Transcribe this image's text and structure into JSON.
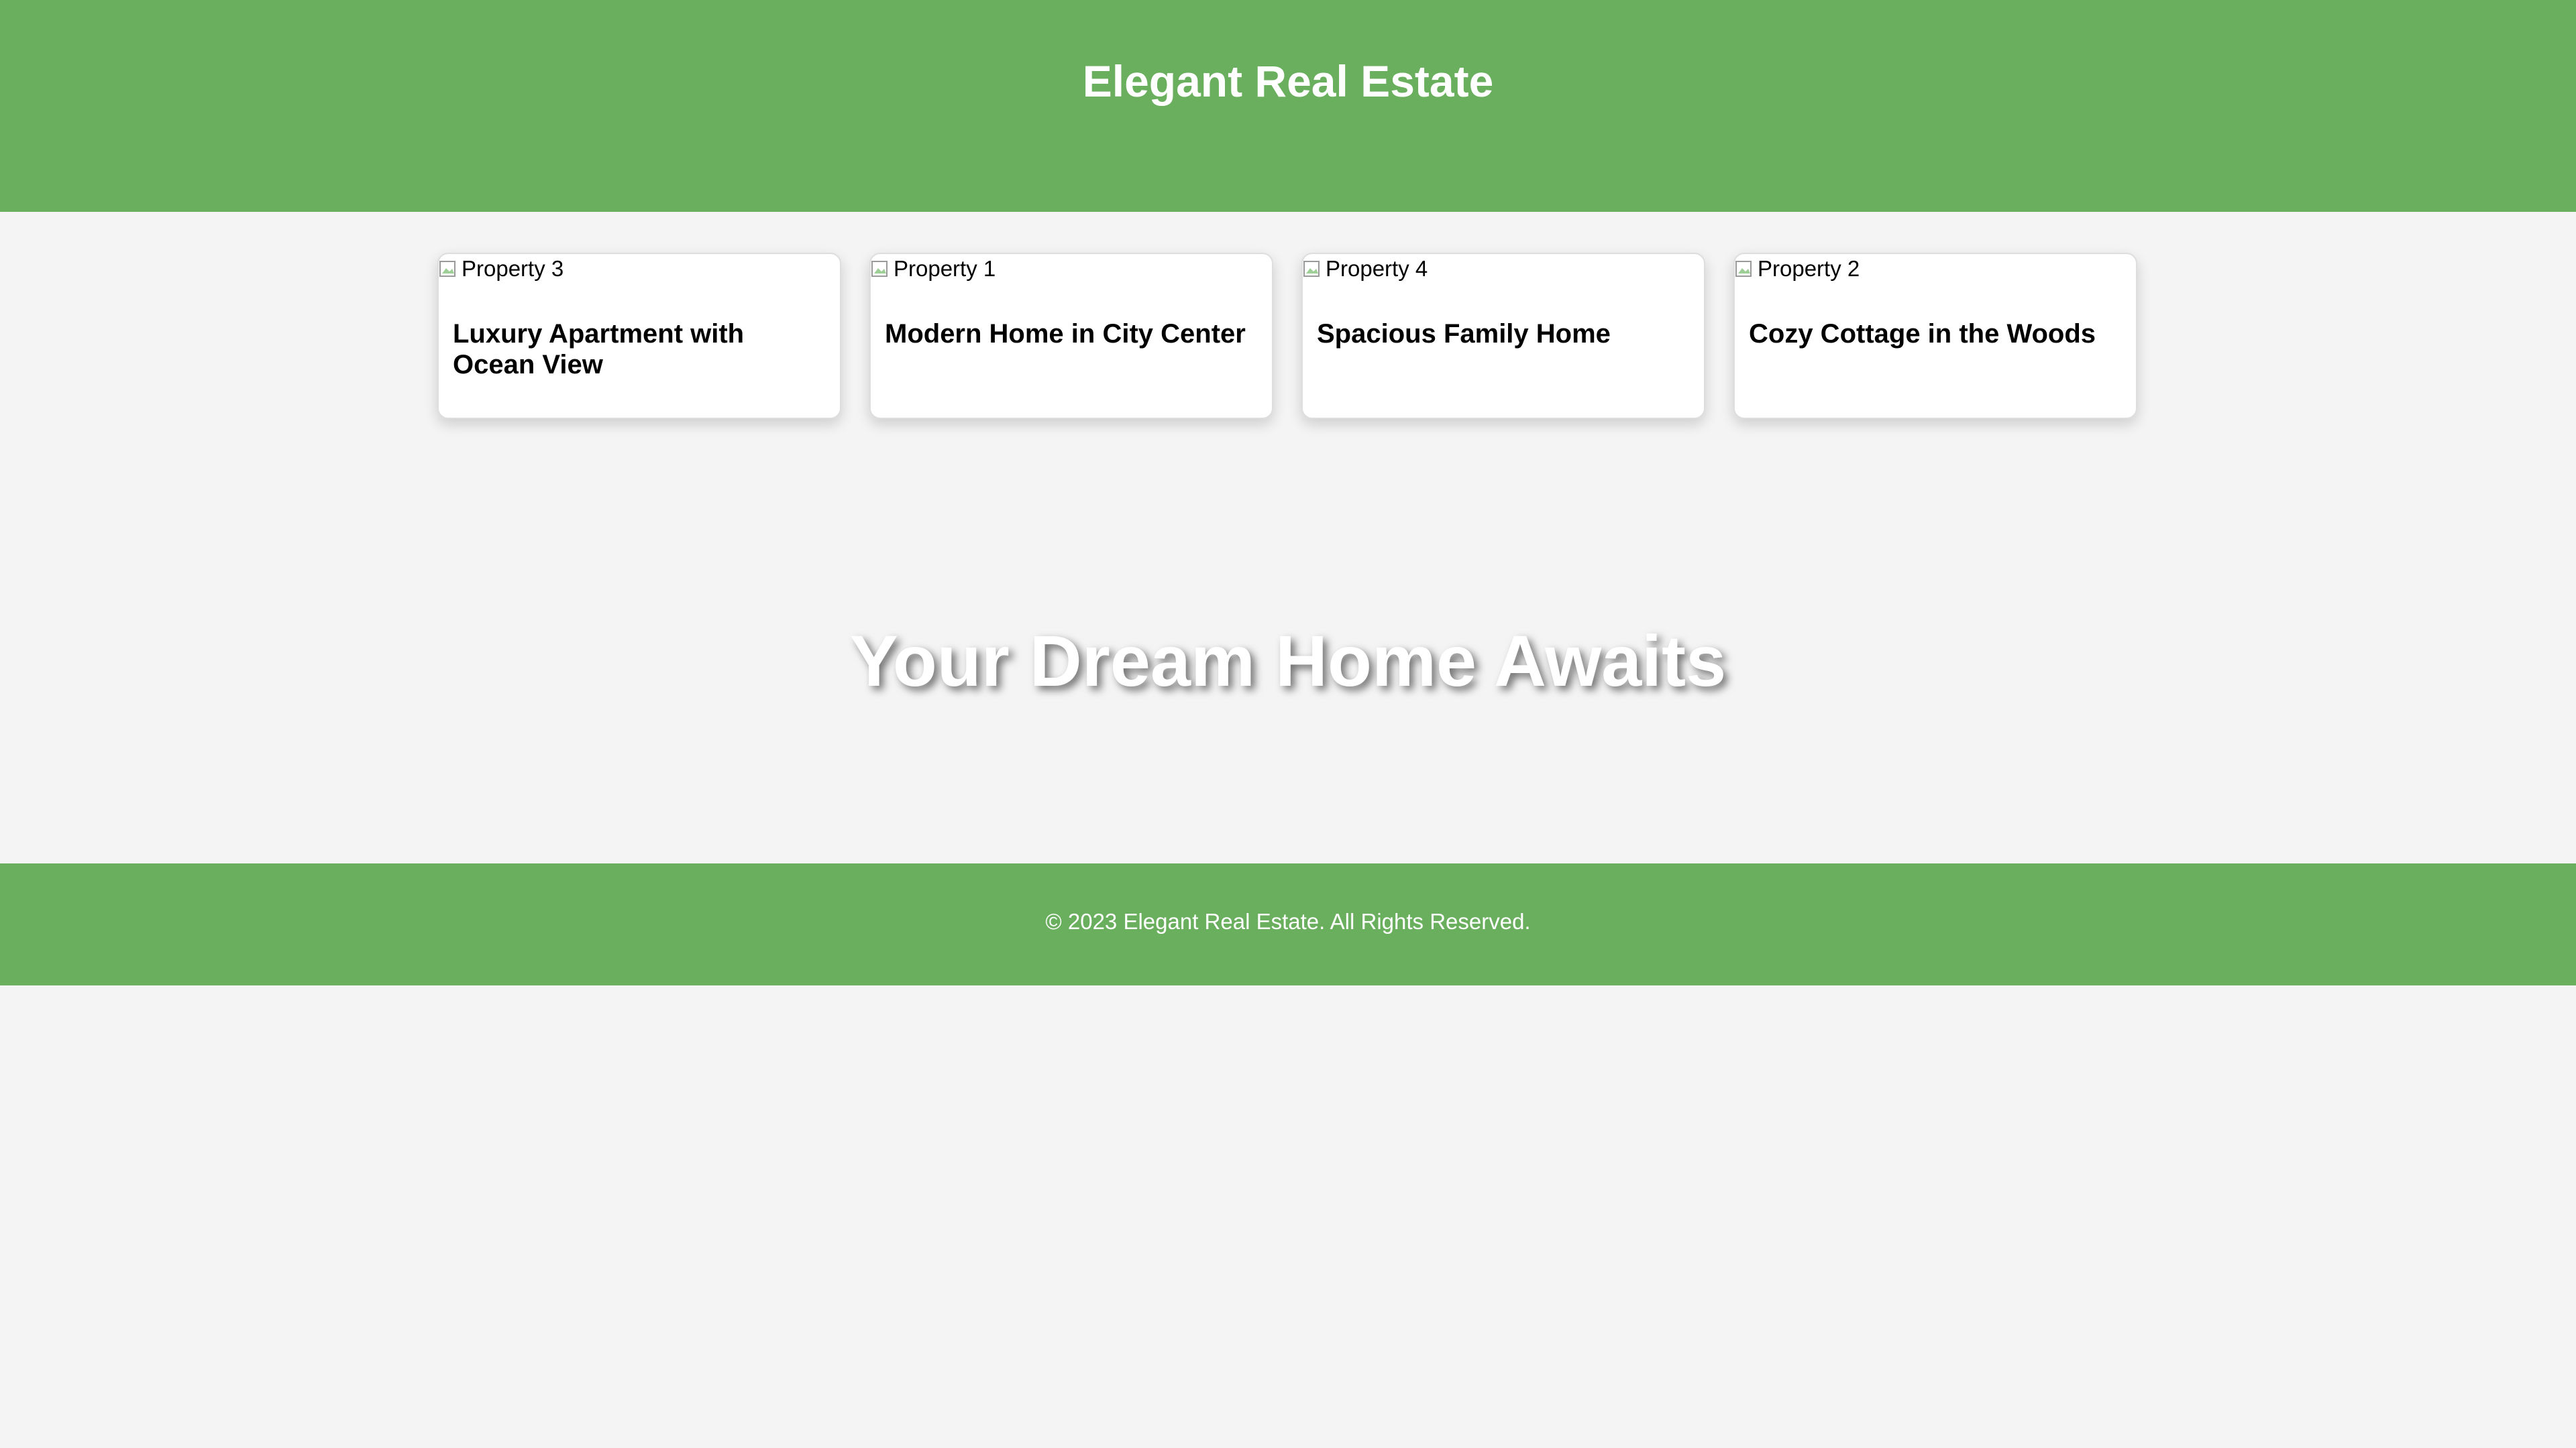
{
  "header": {
    "title": "Elegant Real Estate"
  },
  "listings": [
    {
      "image_alt": "Property 3",
      "title": "Luxury Apartment with Ocean View"
    },
    {
      "image_alt": "Property 1",
      "title": "Modern Home in City Center"
    },
    {
      "image_alt": "Property 4",
      "title": "Spacious Family Home"
    },
    {
      "image_alt": "Property 2",
      "title": "Cozy Cottage in the Woods"
    }
  ],
  "hero": {
    "title": "Your Dream Home Awaits"
  },
  "footer": {
    "text": "© 2023 Elegant Real Estate. All Rights Reserved."
  },
  "icons": {
    "broken_image": "broken-image-icon"
  },
  "colors": {
    "brand_green": "#6aaf5e",
    "page_background": "#f4f4f4",
    "card_background": "#ffffff",
    "header_text": "#ffffff"
  }
}
